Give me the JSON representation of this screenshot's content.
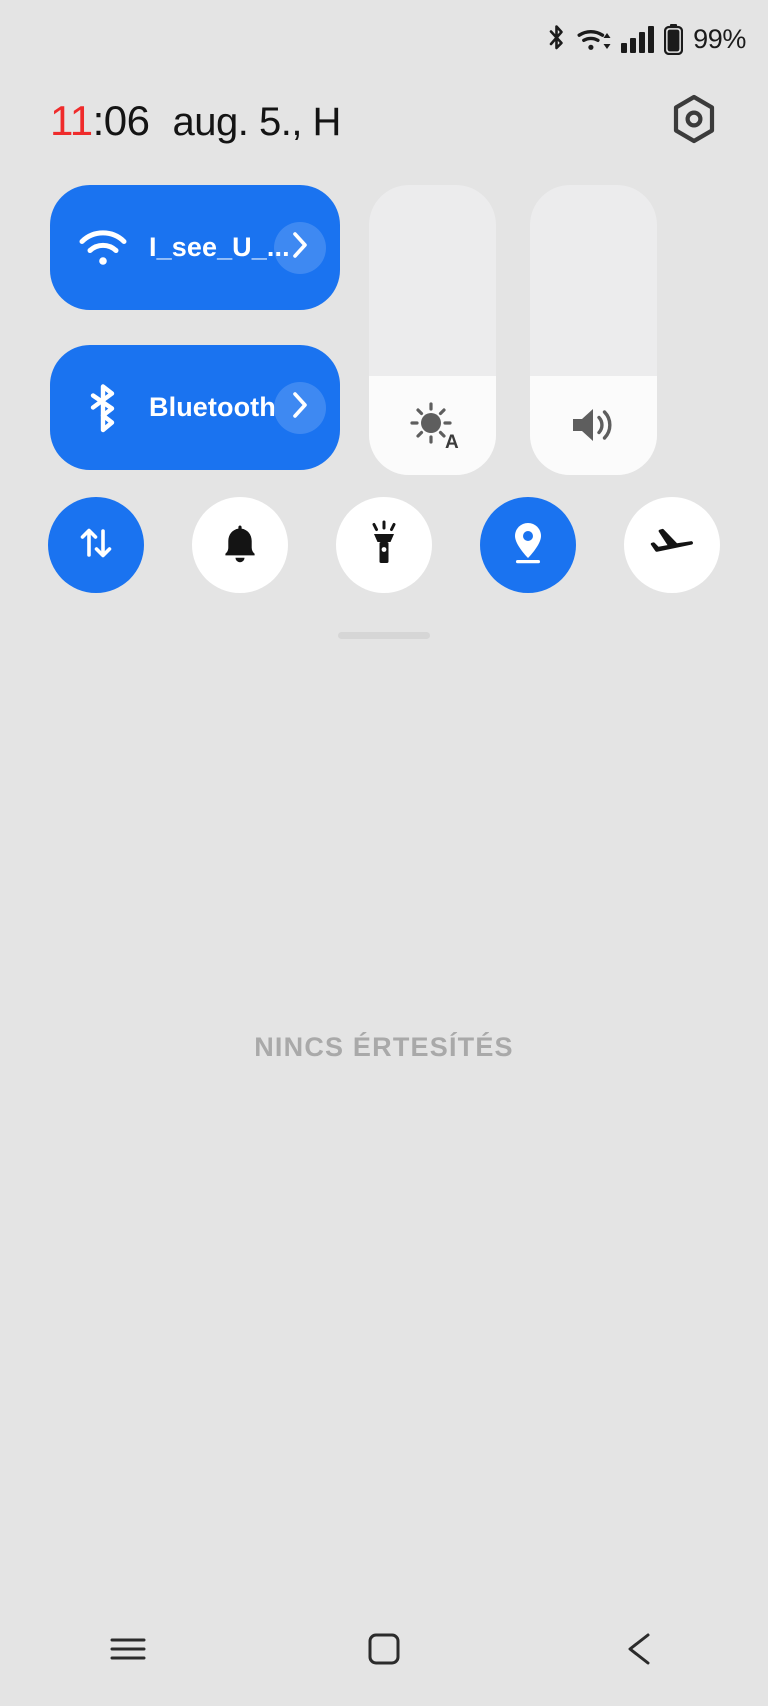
{
  "status_bar": {
    "icons": [
      {
        "name": "bluetooth-icon"
      },
      {
        "name": "wifi-icon"
      },
      {
        "name": "cellular-signal-icon"
      },
      {
        "name": "battery-icon"
      }
    ],
    "battery_percent": "99%"
  },
  "header": {
    "clock_hour": "11",
    "clock_minute": ":06",
    "date": "aug. 5., H",
    "settings_icon": "settings-gear-icon"
  },
  "colors": {
    "accent_blue": "#1a73f0",
    "panel_background": "#e4e4e4",
    "tile_off": "#ffffff",
    "slider_track": "#ececed",
    "slider_fill": "#fbfbfb",
    "clock_hour_red": "#ef2b2b",
    "muted_text": "#a9a9a9"
  },
  "quick_settings": {
    "big_tiles": [
      {
        "name": "wifi-tile",
        "icon": "wifi-icon",
        "label": "I_see_U_...",
        "state": "on",
        "chevron": "chevron-right-icon"
      },
      {
        "name": "bluetooth-tile",
        "icon": "bluetooth-icon",
        "label": "Bluetooth",
        "state": "on",
        "chevron": "chevron-right-icon"
      }
    ],
    "sliders": [
      {
        "name": "brightness-slider",
        "icon": "brightness-auto-icon",
        "fill_percent": 34
      },
      {
        "name": "volume-slider",
        "icon": "volume-icon",
        "fill_percent": 34
      }
    ],
    "toggles": [
      {
        "name": "mobile-data-toggle",
        "icon": "data-transfer-icon",
        "state": "on"
      },
      {
        "name": "sound-toggle",
        "icon": "bell-icon",
        "state": "off"
      },
      {
        "name": "flashlight-toggle",
        "icon": "flashlight-icon",
        "state": "off"
      },
      {
        "name": "location-toggle",
        "icon": "location-pin-icon",
        "state": "on"
      },
      {
        "name": "airplane-mode-toggle",
        "icon": "airplane-icon",
        "state": "off"
      }
    ],
    "drag_handle": "panel-drag-handle"
  },
  "notifications": {
    "empty_text": "NINCS ÉRTESÍTÉS"
  },
  "nav_bar": {
    "buttons": [
      {
        "name": "recents-button",
        "icon": "menu-icon"
      },
      {
        "name": "home-button",
        "icon": "square-icon"
      },
      {
        "name": "back-button",
        "icon": "triangle-left-icon"
      }
    ]
  }
}
